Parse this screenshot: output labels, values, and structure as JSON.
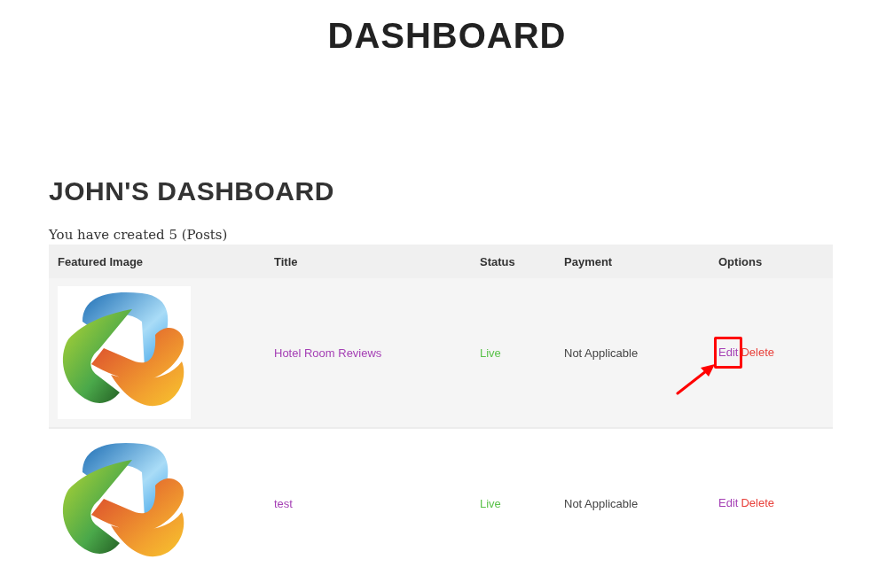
{
  "page_title": "DASHBOARD",
  "dashboard": {
    "heading": "JOHN'S DASHBOARD",
    "summary": "You have created 5 (Posts)",
    "table": {
      "columns": [
        "Featured Image",
        "Title",
        "Status",
        "Payment",
        "Options"
      ],
      "rows": [
        {
          "title": "Hotel Room Reviews",
          "status": "Live",
          "payment": "Not Applicable",
          "actions": [
            "Edit",
            "Delete"
          ],
          "highlighted": true
        },
        {
          "title": "test",
          "status": "Live",
          "payment": "Not Applicable",
          "actions": [
            "Edit",
            "Delete"
          ],
          "highlighted": false
        }
      ]
    }
  }
}
